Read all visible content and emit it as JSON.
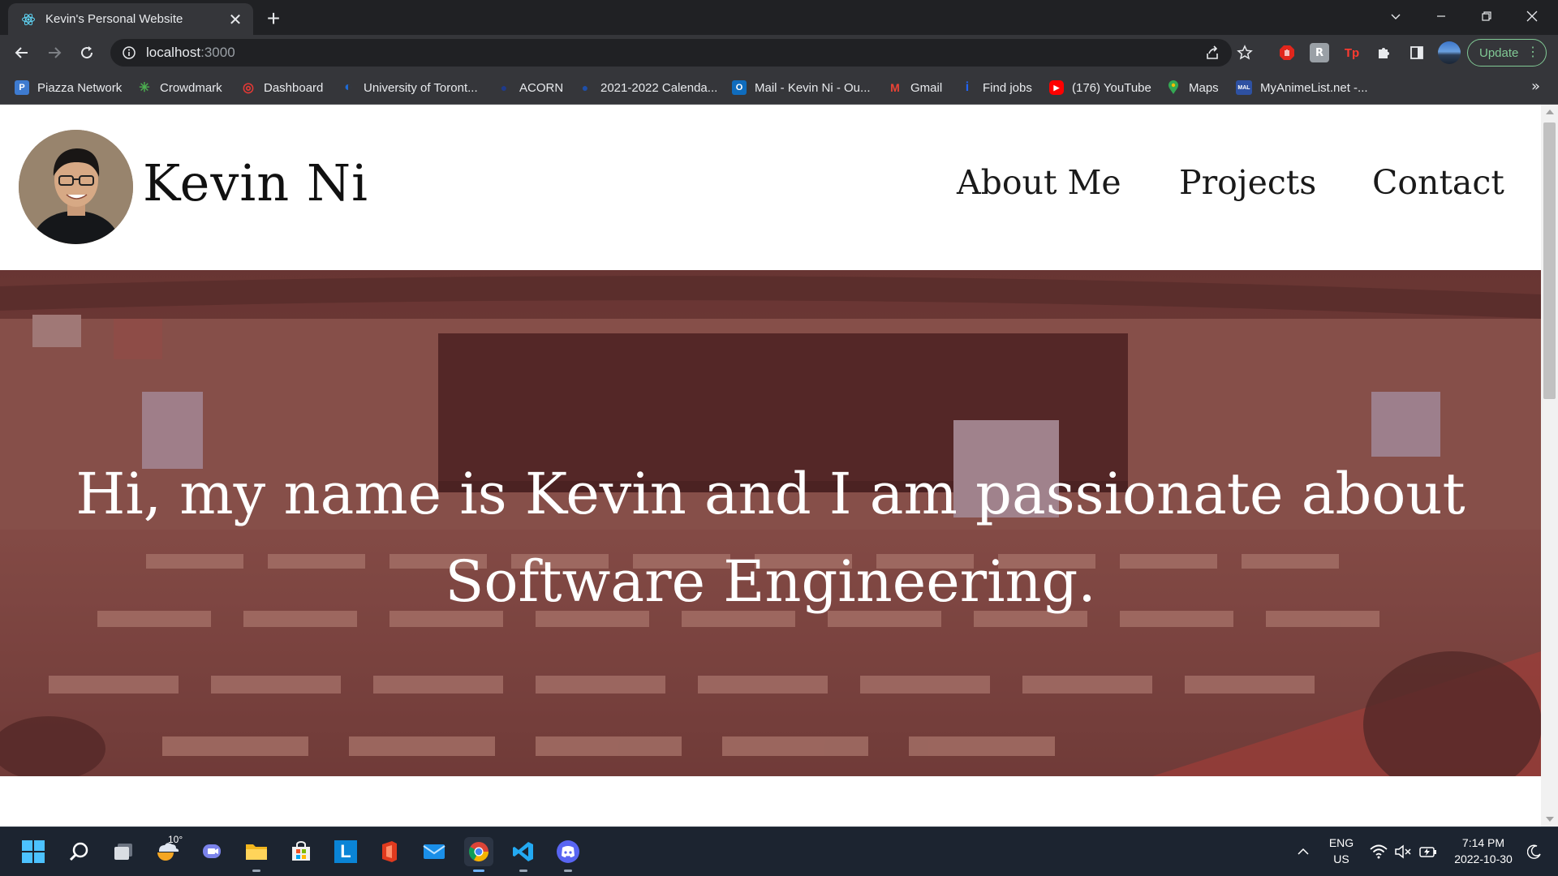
{
  "browser": {
    "tab": {
      "title": "Kevin's Personal Website",
      "favicon": "react-icon"
    },
    "address": {
      "host": "localhost",
      "port": ":3000"
    },
    "update_label": "Update",
    "bookmarks": [
      {
        "label": "Piazza Network",
        "icon": "piazza-icon",
        "color": "#3e7bd0",
        "glyph": "P"
      },
      {
        "label": "Crowdmark",
        "icon": "crowdmark-icon",
        "color": "#4caf50",
        "glyph": "✳"
      },
      {
        "label": "Dashboard",
        "icon": "dashboard-icon",
        "color": "#e53935",
        "glyph": "◎"
      },
      {
        "label": "University of Toront...",
        "icon": "uoft-icon",
        "color": "#1e6bd6",
        "glyph": "◐"
      },
      {
        "label": "ACORN",
        "icon": "acorn-icon",
        "color": "#1f3a8a",
        "glyph": "●"
      },
      {
        "label": "2021-2022 Calenda...",
        "icon": "calendar-icon",
        "color": "#1f4fa8",
        "glyph": "●"
      },
      {
        "label": "Mail - Kevin Ni - Ou...",
        "icon": "outlook-icon",
        "color": "#0f6cbd",
        "glyph": "O"
      },
      {
        "label": "Gmail",
        "icon": "gmail-icon",
        "color": "#ea4335",
        "glyph": "M"
      },
      {
        "label": "Find jobs",
        "icon": "indeed-icon",
        "color": "#2164f3",
        "glyph": "i"
      },
      {
        "label": "(176) YouTube",
        "icon": "youtube-icon",
        "color": "#ff0000",
        "glyph": "▶"
      },
      {
        "label": "Maps",
        "icon": "maps-icon",
        "color": "#34a853",
        "glyph": "⬤"
      },
      {
        "label": "MyAnimeList.net -...",
        "icon": "myanimelist-icon",
        "color": "#2e51a2",
        "glyph": "MAL"
      }
    ]
  },
  "site": {
    "name": "Kevin Ni",
    "nav": [
      "About Me",
      "Projects",
      "Contact"
    ],
    "hero_text": "Hi, my name is Kevin and I am passionate about Software Engineering."
  },
  "taskbar": {
    "weather": "10°",
    "language": {
      "line1": "ENG",
      "line2": "US"
    },
    "time": "7:14 PM",
    "date": "2022-10-30"
  }
}
